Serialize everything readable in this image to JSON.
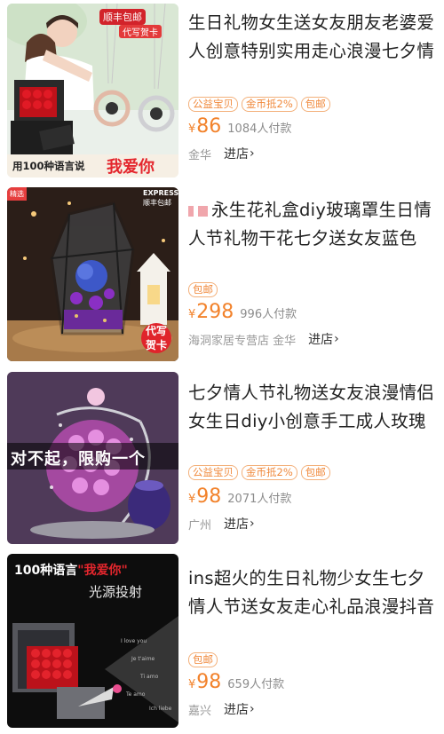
{
  "products": [
    {
      "title": "生日礼物女生送女友朋友老婆爱人创意特别实用走心浪漫七夕情",
      "tags": [
        "公益宝贝",
        "金币抵2%",
        "包邮"
      ],
      "currency": "¥",
      "price": "86",
      "sales": "1084人付款",
      "shop": "金华",
      "enter": "进店",
      "image_text": {
        "shipping": "顺丰包邮",
        "card": "代写贺卡",
        "slogan_a": "用100种语言说",
        "slogan_b": "我爱你"
      }
    },
    {
      "title": "永生花礼盒diy玻璃罩生日情人节礼物干花七夕送女友蓝色",
      "tags": [
        "包邮"
      ],
      "currency": "¥",
      "price": "298",
      "sales": "996人付款",
      "shop": "海洞家居专营店 金华",
      "enter": "进店",
      "image_text": {
        "corner": "精选",
        "express": "EXPRESS",
        "shipping": "顺丰包邮",
        "card_a": "代写",
        "card_b": "贺卡"
      }
    },
    {
      "title": "七夕情人节礼物送女友浪漫情侣女生日diy小创意手工成人玫瑰",
      "tags": [
        "公益宝贝",
        "金币抵2%",
        "包邮"
      ],
      "currency": "¥",
      "price": "98",
      "sales": "2071人付款",
      "shop": "广州",
      "enter": "进店",
      "image_text": {
        "banner": "对不起，限购一个"
      }
    },
    {
      "title": "ins超火的生日礼物少女生七夕情人节送女友走心礼品浪漫抖音",
      "tags": [
        "包邮"
      ],
      "currency": "¥",
      "price": "98",
      "sales": "659人付款",
      "shop": "嘉兴",
      "enter": "进店",
      "image_text": {
        "line1_a": "100种语言",
        "line1_b": "\"我爱你\"",
        "line2": "光源投射"
      }
    }
  ],
  "colors": {
    "price": "#f2822b",
    "tag_border": "#f3b07a",
    "title": "#222222",
    "muted": "#999999"
  }
}
